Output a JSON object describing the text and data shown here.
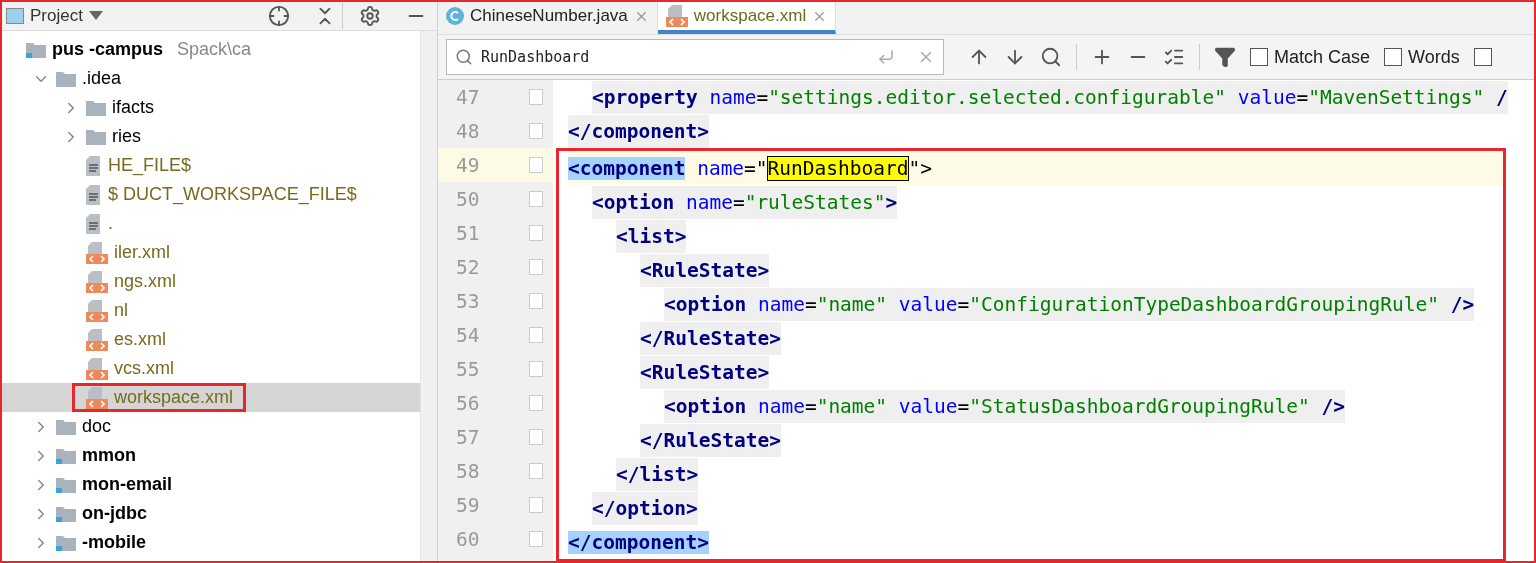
{
  "project_panel": {
    "title": "Project",
    "framed": true,
    "tree": [
      {
        "label": "pus -campus",
        "path": "Spack\\ca",
        "kind": "module",
        "selected": false,
        "boxed": false,
        "children": [
          {
            "label": ".idea",
            "kind": "folder",
            "expanded": true,
            "selected": false,
            "boxed": false,
            "children": [
              {
                "label": "ifacts",
                "kind": "folder",
                "expanded": false,
                "selected": false,
                "boxed": false
              },
              {
                "label": "ries",
                "kind": "folder",
                "expanded": false,
                "selected": false,
                "boxed": false
              },
              {
                "label": "HE_FILE$",
                "kind": "file",
                "selected": false,
                "boxed": false
              },
              {
                "label": "$ DUCT_WORKSPACE_FILE$",
                "kind": "file",
                "selected": false,
                "boxed": false
              },
              {
                "label": ".",
                "kind": "file",
                "selected": false,
                "boxed": false
              },
              {
                "label": "iler.xml",
                "kind": "xml",
                "selected": false,
                "boxed": false
              },
              {
                "label": "ngs.xml",
                "kind": "xml",
                "selected": false,
                "boxed": false
              },
              {
                "label": "nl",
                "kind": "xml",
                "selected": false,
                "boxed": false
              },
              {
                "label": "es.xml",
                "kind": "xml",
                "selected": false,
                "boxed": false
              },
              {
                "label": "vcs.xml",
                "kind": "xml",
                "selected": false,
                "boxed": false
              },
              {
                "label": "workspace.xml",
                "kind": "xml",
                "selected": true,
                "boxed": true
              }
            ]
          },
          {
            "label": "doc",
            "kind": "folder",
            "expanded": false,
            "selected": false,
            "boxed": false
          },
          {
            "label": "mmon",
            "kind": "module",
            "expanded": false,
            "selected": false,
            "boxed": false
          },
          {
            "label": "mon-email",
            "kind": "module",
            "expanded": false,
            "selected": false,
            "boxed": false
          },
          {
            "label": "on-jdbc",
            "kind": "module",
            "expanded": false,
            "selected": false,
            "boxed": false
          },
          {
            "label": "-mobile",
            "kind": "module",
            "expanded": false,
            "selected": false,
            "boxed": false
          }
        ]
      }
    ]
  },
  "editor": {
    "tabs": [
      {
        "label": "ChineseNumber.java",
        "kind": "java",
        "selected": false
      },
      {
        "label": "workspace.xml",
        "kind": "xml",
        "selected": true
      }
    ],
    "search": {
      "value": "RunDashboard",
      "options": [
        {
          "label": "Match Case",
          "checked": false
        },
        {
          "label": "Words",
          "checked": false
        },
        {
          "checked": false
        }
      ]
    },
    "lines": [
      {
        "children": [
          {
            "number": "47",
            "current": false,
            "boxed": false,
            "shaded": true,
            "tokens": [
              {
                "kind": "tag",
                "text": "<property"
              },
              {
                "kind": "attr",
                "text": " name"
              },
              {
                "kind": "plain",
                "text": "="
              },
              {
                "kind": "val",
                "text": "\"settings.editor.selected.configurable\""
              },
              {
                "kind": "attr",
                "text": " value"
              },
              {
                "kind": "plain",
                "text": "="
              },
              {
                "kind": "val",
                "text": "\"MavenSettings\""
              },
              {
                "kind": "tag",
                "text": " /"
              }
            ]
          }
        ]
      },
      {
        "number": "48",
        "current": false,
        "boxed": false,
        "shaded": true,
        "tokens": [
          {
            "kind": "tag",
            "text": "</component>"
          }
        ]
      },
      {
        "number": "49",
        "current": true,
        "boxed": true,
        "shaded": false,
        "tokens": [
          {
            "kind": "selected-tag",
            "text": "<component"
          },
          {
            "kind": "attr",
            "text": " name"
          },
          {
            "kind": "plain",
            "text": "=\""
          },
          {
            "kind": "search-match",
            "text": "RunDashboard"
          },
          {
            "kind": "plain",
            "text": "\">"
          }
        ],
        "children": [
          {
            "number": "50",
            "current": false,
            "boxed": true,
            "shaded": true,
            "tokens": [
              {
                "kind": "tag",
                "text": "<option"
              },
              {
                "kind": "attr",
                "text": " name"
              },
              {
                "kind": "plain",
                "text": "="
              },
              {
                "kind": "val",
                "text": "\"ruleStates\""
              },
              {
                "kind": "tag",
                "text": ">"
              }
            ],
            "children": [
              {
                "number": "51",
                "current": false,
                "boxed": true,
                "shaded": true,
                "tokens": [
                  {
                    "kind": "tag",
                    "text": "<list>"
                  }
                ],
                "children": [
                  {
                    "number": "52",
                    "current": false,
                    "boxed": true,
                    "shaded": true,
                    "tokens": [
                      {
                        "kind": "tag",
                        "text": "<RuleState>"
                      }
                    ],
                    "children": [
                      {
                        "number": "53",
                        "current": false,
                        "boxed": true,
                        "shaded": true,
                        "tokens": [
                          {
                            "kind": "tag",
                            "text": "<option"
                          },
                          {
                            "kind": "attr",
                            "text": " name"
                          },
                          {
                            "kind": "plain",
                            "text": "="
                          },
                          {
                            "kind": "val",
                            "text": "\"name\""
                          },
                          {
                            "kind": "attr",
                            "text": " value"
                          },
                          {
                            "kind": "plain",
                            "text": "="
                          },
                          {
                            "kind": "val",
                            "text": "\"ConfigurationTypeDashboardGroupingRule\""
                          },
                          {
                            "kind": "tag",
                            "text": " />"
                          }
                        ]
                      }
                    ]
                  },
                  {
                    "number": "54",
                    "current": false,
                    "boxed": true,
                    "shaded": true,
                    "tokens": [
                      {
                        "kind": "tag",
                        "text": "</RuleState>"
                      }
                    ]
                  },
                  {
                    "number": "55",
                    "current": false,
                    "boxed": true,
                    "shaded": true,
                    "tokens": [
                      {
                        "kind": "tag",
                        "text": "<RuleState>"
                      }
                    ],
                    "children": [
                      {
                        "number": "56",
                        "current": false,
                        "boxed": true,
                        "shaded": true,
                        "tokens": [
                          {
                            "kind": "tag",
                            "text": "<option"
                          },
                          {
                            "kind": "attr",
                            "text": " name"
                          },
                          {
                            "kind": "plain",
                            "text": "="
                          },
                          {
                            "kind": "val",
                            "text": "\"name\""
                          },
                          {
                            "kind": "attr",
                            "text": " value"
                          },
                          {
                            "kind": "plain",
                            "text": "="
                          },
                          {
                            "kind": "val",
                            "text": "\"StatusDashboardGroupingRule\""
                          },
                          {
                            "kind": "tag",
                            "text": " />"
                          }
                        ]
                      }
                    ]
                  },
                  {
                    "number": "57",
                    "current": false,
                    "boxed": true,
                    "shaded": true,
                    "tokens": [
                      {
                        "kind": "tag",
                        "text": "</RuleState>"
                      }
                    ]
                  }
                ]
              },
              {
                "number": "58",
                "current": false,
                "boxed": true,
                "shaded": true,
                "tokens": [
                  {
                    "kind": "tag",
                    "text": "</list>"
                  }
                ]
              }
            ]
          },
          {
            "number": "59",
            "current": false,
            "boxed": true,
            "shaded": true,
            "tokens": [
              {
                "kind": "tag",
                "text": "</option>"
              }
            ]
          }
        ]
      },
      {
        "number": "60",
        "current": false,
        "boxed": true,
        "shaded": false,
        "tokens": [
          {
            "kind": "selected-tag",
            "text": "</component>"
          }
        ]
      }
    ]
  }
}
